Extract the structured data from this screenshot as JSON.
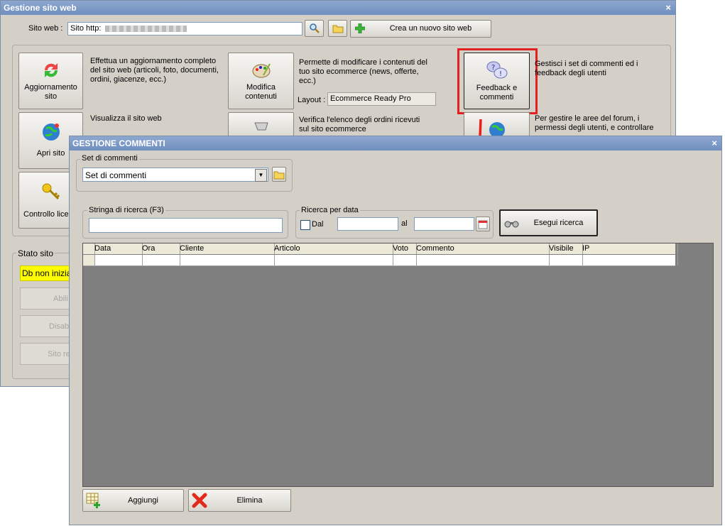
{
  "main_window": {
    "title": "Gestione sito web",
    "site_label": "Sito web :",
    "site_value": "Sito http:",
    "new_site_label": "Crea un nuovo sito web",
    "tiles": [
      {
        "label": "Aggiornamento sito",
        "desc": "Effettua un aggiornamento completo del sito web (articoli, foto, documenti, ordini, giacenze, ecc.)"
      },
      {
        "label": "Apri sito",
        "desc": "Visualizza il sito web"
      },
      {
        "label": "Controllo licenze"
      },
      {
        "label": "Modifica contenuti",
        "desc": "Permette di modificare i contenuti del tuo sito ecommerce (news, offerte, ecc.)"
      },
      {
        "desc": "Verifica l'elenco degli ordini ricevuti sul sito ecommerce"
      },
      {
        "label": "Feedback e commenti",
        "desc": "Gestisci i set di commenti ed i feedback degli utenti"
      },
      {
        "desc": "Per gestire le aree del forum, i permessi degli utenti, e controllare"
      }
    ],
    "layout_label": "Layout :",
    "layout_value": "Ecommerce Ready Pro",
    "status_group": "Stato sito",
    "status_value": "Db non inizia",
    "status_buttons": [
      "Abili",
      "Disabi",
      "Sito re"
    ]
  },
  "dialog": {
    "title": "GESTIONE COMMENTI",
    "set_group": "Set di commenti",
    "set_select": "Set di commenti",
    "search_group": "Stringa di ricerca (F3)",
    "search_value": "",
    "date_group": "Ricerca per data",
    "dal_label": "Dal",
    "al_label": "al",
    "search_button": "Esegui ricerca",
    "columns": [
      "Data",
      "Ora",
      "Cliente",
      "Articolo",
      "Voto",
      "Commento",
      "Visibile",
      "IP"
    ],
    "add_button": "Aggiungi",
    "delete_button": "Elimina"
  },
  "colors": {
    "highlight": "#ff0000",
    "status_bg": "#ffff00",
    "title_bg": "#7a97c8"
  }
}
